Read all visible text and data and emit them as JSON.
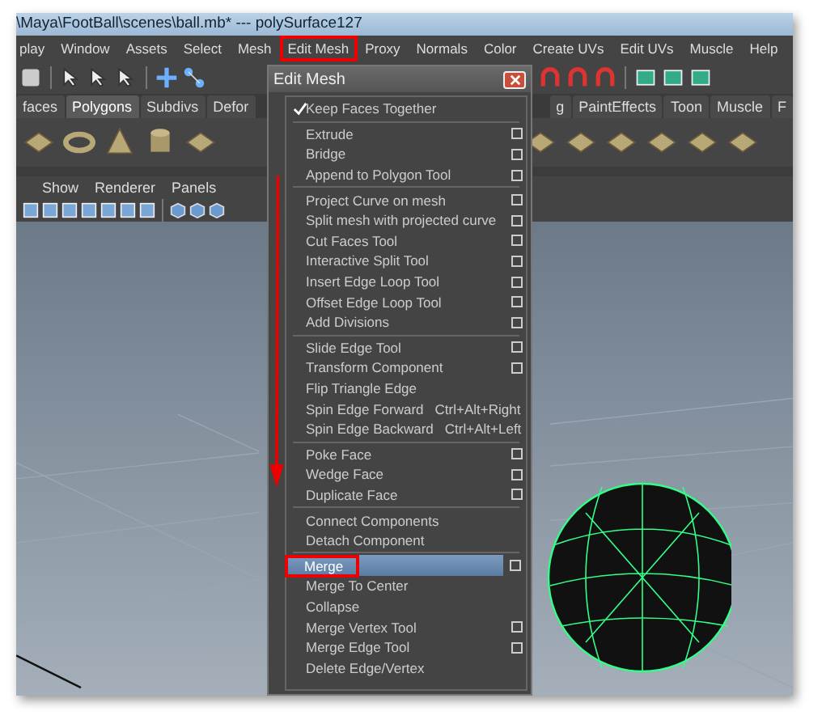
{
  "window": {
    "title": "\\Maya\\FootBall\\scenes\\ball.mb*  ---  polySurface127"
  },
  "menu_bar": [
    {
      "label": "play",
      "annotated": false
    },
    {
      "label": "Window",
      "annotated": false
    },
    {
      "label": "Assets",
      "annotated": false
    },
    {
      "label": "Select",
      "annotated": false
    },
    {
      "label": "Mesh",
      "annotated": false
    },
    {
      "label": "Edit Mesh",
      "annotated": true
    },
    {
      "label": "Proxy",
      "annotated": false
    },
    {
      "label": "Normals",
      "annotated": false
    },
    {
      "label": "Color",
      "annotated": false
    },
    {
      "label": "Create UVs",
      "annotated": false
    },
    {
      "label": "Edit UVs",
      "annotated": false
    },
    {
      "label": "Muscle",
      "annotated": false
    },
    {
      "label": "Help",
      "annotated": false
    }
  ],
  "shelf_tabs": [
    {
      "label": "faces",
      "selected": false
    },
    {
      "label": "Polygons",
      "selected": true
    },
    {
      "label": "Subdivs",
      "selected": false
    },
    {
      "label": "Defor",
      "selected": false
    },
    {
      "label": "g",
      "selected": false
    },
    {
      "label": "PaintEffects",
      "selected": false
    },
    {
      "label": "Toon",
      "selected": false
    },
    {
      "label": "Muscle",
      "selected": false
    },
    {
      "label": "F",
      "selected": false
    }
  ],
  "panel_menu": [
    "Show",
    "Renderer",
    "Panels"
  ],
  "edit_mesh_menu": {
    "title": "Edit Mesh",
    "groups": [
      [
        {
          "kind": "check",
          "label": "Keep Faces Together",
          "checked": true,
          "selected": false,
          "annotated": false
        }
      ],
      [
        {
          "kind": "command",
          "label": "Extrude",
          "option_box": true,
          "selected": false,
          "annotated": false
        },
        {
          "kind": "command",
          "label": "Bridge",
          "option_box": true,
          "selected": false,
          "annotated": false
        },
        {
          "kind": "command",
          "label": "Append to Polygon Tool",
          "option_box": true,
          "selected": false,
          "annotated": false
        }
      ],
      [
        {
          "kind": "command",
          "label": "Project Curve on mesh",
          "option_box": true,
          "selected": false,
          "annotated": false
        },
        {
          "kind": "command",
          "label": "Split mesh with projected curve",
          "option_box": true,
          "selected": false,
          "annotated": false
        },
        {
          "kind": "command",
          "label": "Cut Faces Tool",
          "option_box": true,
          "selected": false,
          "annotated": false
        },
        {
          "kind": "command",
          "label": "Interactive Split Tool",
          "option_box": true,
          "selected": false,
          "annotated": false
        },
        {
          "kind": "command",
          "label": "Insert Edge Loop Tool",
          "option_box": true,
          "selected": false,
          "annotated": false
        },
        {
          "kind": "command",
          "label": "Offset Edge Loop Tool",
          "option_box": true,
          "selected": false,
          "annotated": false
        },
        {
          "kind": "command",
          "label": "Add Divisions",
          "option_box": true,
          "selected": false,
          "annotated": false
        }
      ],
      [
        {
          "kind": "command",
          "label": "Slide Edge Tool",
          "option_box": true,
          "selected": false,
          "annotated": false
        },
        {
          "kind": "command",
          "label": "Transform Component",
          "option_box": true,
          "selected": false,
          "annotated": false
        },
        {
          "kind": "command",
          "label": "Flip Triangle Edge",
          "option_box": false,
          "selected": false,
          "annotated": false
        },
        {
          "kind": "command",
          "label": "Spin Edge Forward",
          "shortcut": "Ctrl+Alt+Right",
          "option_box": false,
          "selected": false,
          "annotated": false
        },
        {
          "kind": "command",
          "label": "Spin Edge Backward",
          "shortcut": "Ctrl+Alt+Left",
          "option_box": false,
          "selected": false,
          "annotated": false
        }
      ],
      [
        {
          "kind": "command",
          "label": "Poke Face",
          "option_box": true,
          "selected": false,
          "annotated": false
        },
        {
          "kind": "command",
          "label": "Wedge Face",
          "option_box": true,
          "selected": false,
          "annotated": false
        },
        {
          "kind": "command",
          "label": "Duplicate Face",
          "option_box": true,
          "selected": false,
          "annotated": false
        }
      ],
      [
        {
          "kind": "command",
          "label": "Connect Components",
          "option_box": false,
          "selected": false,
          "annotated": false
        },
        {
          "kind": "command",
          "label": "Detach Component",
          "option_box": false,
          "selected": false,
          "annotated": false
        }
      ],
      [
        {
          "kind": "command",
          "label": "Merge",
          "option_box": true,
          "selected": true,
          "annotated": true
        },
        {
          "kind": "command",
          "label": "Merge To Center",
          "option_box": false,
          "selected": false,
          "annotated": false
        },
        {
          "kind": "command",
          "label": "Collapse",
          "option_box": false,
          "selected": false,
          "annotated": false
        },
        {
          "kind": "command",
          "label": "Merge Vertex Tool",
          "option_box": true,
          "selected": false,
          "annotated": false
        },
        {
          "kind": "command",
          "label": "Merge Edge Tool",
          "option_box": true,
          "selected": false,
          "annotated": false
        },
        {
          "kind": "command",
          "label": "Delete Edge/Vertex",
          "option_box": false,
          "selected": false,
          "annotated": false
        }
      ]
    ]
  }
}
